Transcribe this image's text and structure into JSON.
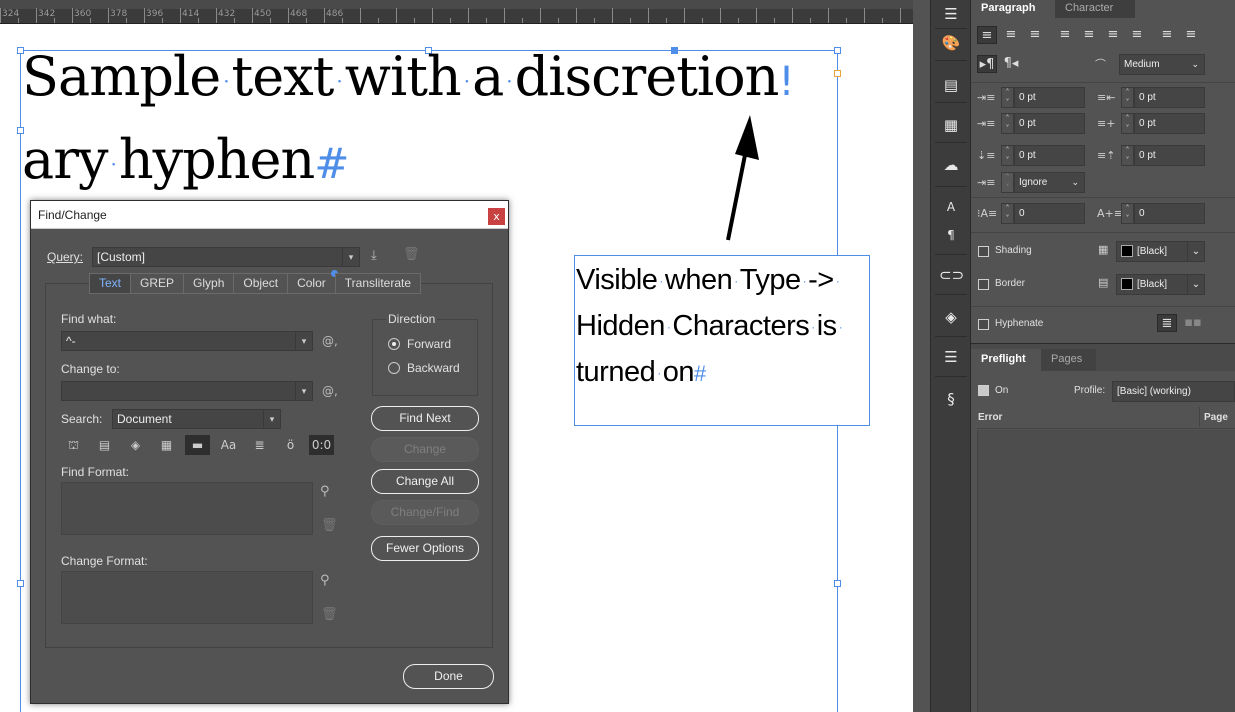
{
  "ruler": {
    "numbers": [
      "324",
      "342",
      "360",
      "378",
      "396",
      "414",
      "432",
      "450",
      "468",
      "486"
    ]
  },
  "document": {
    "main_line1": [
      "Sample",
      "text",
      "with",
      "a",
      "discretion"
    ],
    "main_hyphen_char": "!",
    "main_line2": [
      "ary",
      "hyphen"
    ],
    "main_end_char": "#",
    "note_line1": [
      "Visible",
      "when",
      "Type",
      "->"
    ],
    "note_line2": [
      "Hidden",
      "Characters",
      "is"
    ],
    "note_line3": [
      "turned",
      "on"
    ],
    "note_end_char": "#"
  },
  "dialog": {
    "title": "Find/Change",
    "close": "x",
    "query_label": "Query:",
    "query_value": "[Custom]",
    "tabs": [
      "Text",
      "GREP",
      "Glyph",
      "Object",
      "Color",
      "Transliterate"
    ],
    "active_tab": "Text",
    "find_what_label": "Find what:",
    "find_what_value": "^-",
    "change_to_label": "Change to:",
    "change_to_value": "",
    "at_symbol": "@,",
    "search_label": "Search:",
    "search_value": "Document",
    "option_glyph": "Aa",
    "option_glyph_2": "0:0",
    "find_format_label": "Find Format:",
    "change_format_label": "Change Format:",
    "direction_label": "Direction",
    "forward": "Forward",
    "backward": "Backward",
    "find_next": "Find Next",
    "change": "Change",
    "change_all": "Change All",
    "change_find": "Change/Find",
    "fewer_options": "Fewer Options",
    "done": "Done"
  },
  "panel": {
    "tab_paragraph": "Paragraph",
    "tab_character": "Character",
    "composer": "Medium",
    "left_indent": "0 pt",
    "right_indent": "0 pt",
    "first_indent": "0 pt",
    "last_indent": "0 pt",
    "space_before": "0 pt",
    "space_after": "0 pt",
    "grid_align": "Ignore",
    "drop_lines": "0",
    "drop_chars": "0",
    "shading_label": "Shading",
    "shading_color": "[Black]",
    "border_label": "Border",
    "border_color": "[Black]",
    "hyphenate_label": "Hyphenate",
    "tab_preflight": "Preflight",
    "tab_pages": "Pages",
    "on_label": "On",
    "profile_label": "Profile:",
    "profile_value": "[Basic] (working)",
    "col_error": "Error",
    "col_page": "Page"
  },
  "colors": {
    "accent": "#4f8ee8",
    "panel_bg": "#535353",
    "dialog_bg": "#535353"
  }
}
